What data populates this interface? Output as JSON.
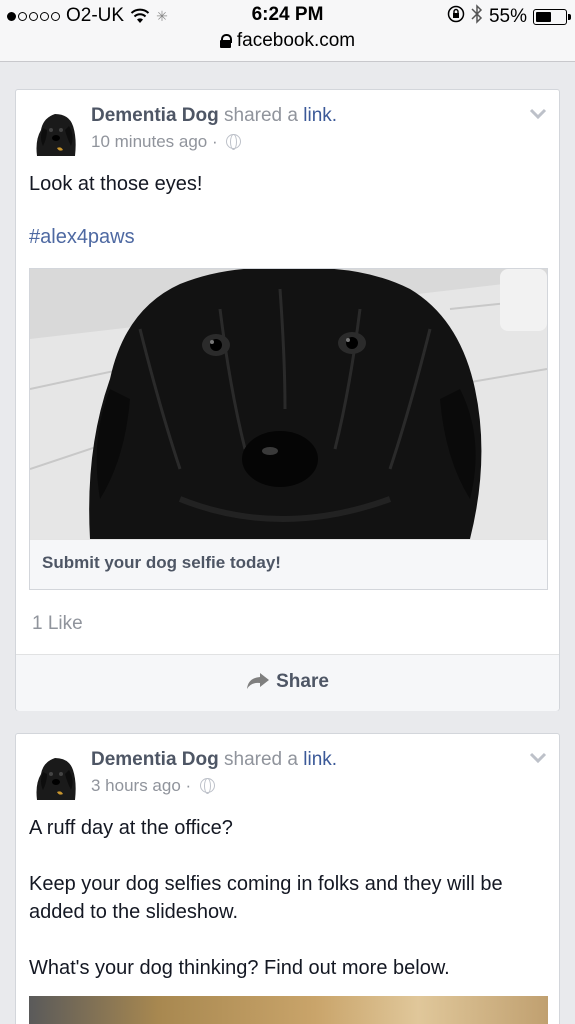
{
  "status_bar": {
    "carrier": "O2-UK",
    "time": "6:24 PM",
    "battery_percent_label": "55%",
    "battery_level": 0.55,
    "signal_bars_on": 1,
    "signal_bars_total": 5
  },
  "url_bar": {
    "domain": "facebook.com"
  },
  "posts": [
    {
      "author": "Dementia Dog",
      "action": "shared a",
      "link_word": "link.",
      "timestamp": "10 minutes ago",
      "text": "Look at those eyes!",
      "hashtag": "#alex4paws",
      "attachment_caption": "Submit your dog selfie today!",
      "likes": "1 Like",
      "share_label": "Share"
    },
    {
      "author": "Dementia Dog",
      "action": "shared a",
      "link_word": "link.",
      "timestamp": "3 hours ago",
      "text_lines": [
        "A ruff day at the office?",
        "Keep your dog selfies coming in folks and they will be added to the slideshow.",
        "What's your dog thinking? Find out more below."
      ]
    }
  ],
  "colors": {
    "background": "#e9eaed",
    "link_blue": "#3b5998",
    "hashtag": "#4e69a2",
    "meta_gray": "#90949c"
  }
}
